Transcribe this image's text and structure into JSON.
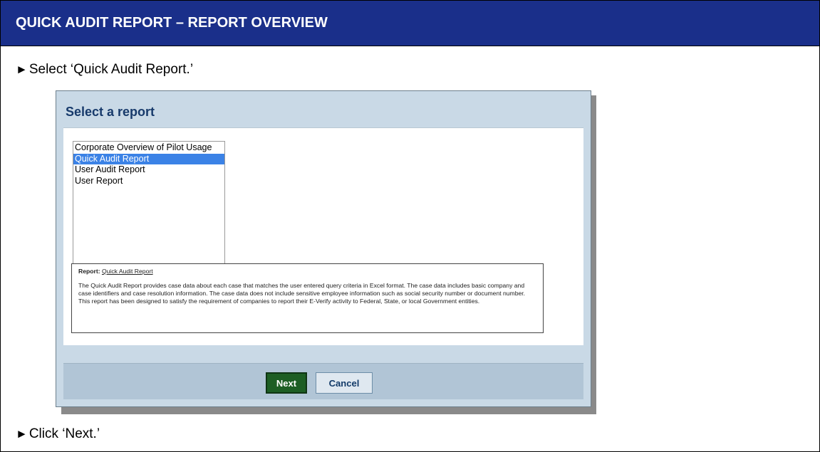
{
  "header": {
    "title": "QUICK AUDIT REPORT – REPORT OVERVIEW"
  },
  "steps": [
    {
      "arrow": "►",
      "text": "Select ‘Quick Audit Report.’"
    },
    {
      "arrow": "►",
      "text": "Click ‘Next.’"
    }
  ],
  "screenshot": {
    "title": "Select a report",
    "report_list": {
      "items": [
        "Corporate Overview of Pilot Usage",
        "Quick Audit Report",
        "User Audit Report",
        "User Report"
      ],
      "selected": "Quick Audit Report"
    },
    "description": {
      "label": "Report:",
      "link": "Quick Audit Report",
      "text": "The Quick Audit Report provides case data about each case that matches the user entered query criteria in Excel format. The case data includes basic company and case identifiers and case resolution information. The case data does not include sensitive employee information such as social security number or document number. This report has been designed to satisfy the requirement of companies to report their E-Verify activity to Federal, State, or local Government entities."
    },
    "buttons": {
      "next": "Next",
      "cancel": "Cancel"
    }
  },
  "colors": {
    "header_bg": "#1a2f8a",
    "selection": "#3b82e6",
    "next_button": "#1d5e24"
  }
}
